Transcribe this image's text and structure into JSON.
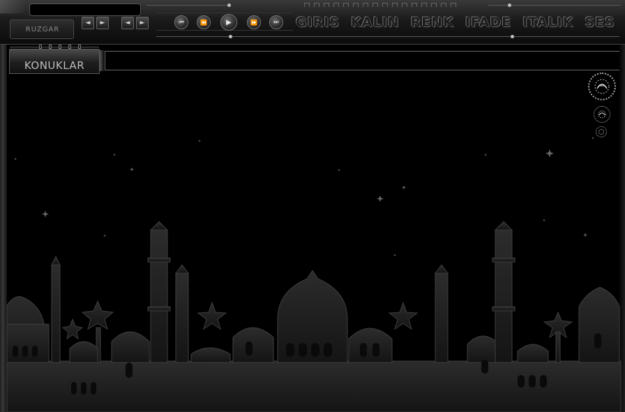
{
  "toolbar": {
    "title_field_value": "",
    "room_label": "RUZGAR",
    "nav_prev_glyph": "◄",
    "nav_next_glyph": "►",
    "media": {
      "first_glyph": "⏮",
      "rewind_glyph": "⏪",
      "play_glyph": "▶",
      "forward_glyph": "⏩",
      "last_glyph": "⏭"
    },
    "menu": [
      "GIRIS",
      "KALIN",
      "RENK",
      "IFADE",
      "ITALIK",
      "SES"
    ]
  },
  "guests_tab": {
    "label": "KONUKLAR"
  },
  "message_input": {
    "value": ""
  },
  "icons": [
    "emblem-large-icon",
    "emblem-medium-icon",
    "emblem-small-icon"
  ],
  "colors": {
    "background": "#000000",
    "frame": "#2a2a2a",
    "silhouette": "#1d1d1d",
    "text": "#9a9a9a"
  }
}
